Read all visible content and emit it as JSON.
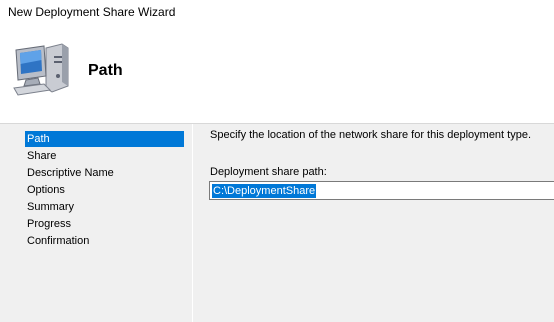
{
  "window": {
    "title": "New Deployment Share Wizard"
  },
  "header": {
    "title": "Path"
  },
  "nav": {
    "items": [
      {
        "label": "Path",
        "active": true
      },
      {
        "label": "Share",
        "active": false
      },
      {
        "label": "Descriptive Name",
        "active": false
      },
      {
        "label": "Options",
        "active": false
      },
      {
        "label": "Summary",
        "active": false
      },
      {
        "label": "Progress",
        "active": false
      },
      {
        "label": "Confirmation",
        "active": false
      }
    ]
  },
  "content": {
    "instruction": "Specify the location of the network share for this deployment type.",
    "path_label": "Deployment share path:",
    "path_value": "C:\\DeploymentShare"
  },
  "colors": {
    "selection": "#0078d7",
    "panel": "#f0f0f0",
    "header": "#ffffff"
  },
  "icons": {
    "header": "computer-icon"
  }
}
